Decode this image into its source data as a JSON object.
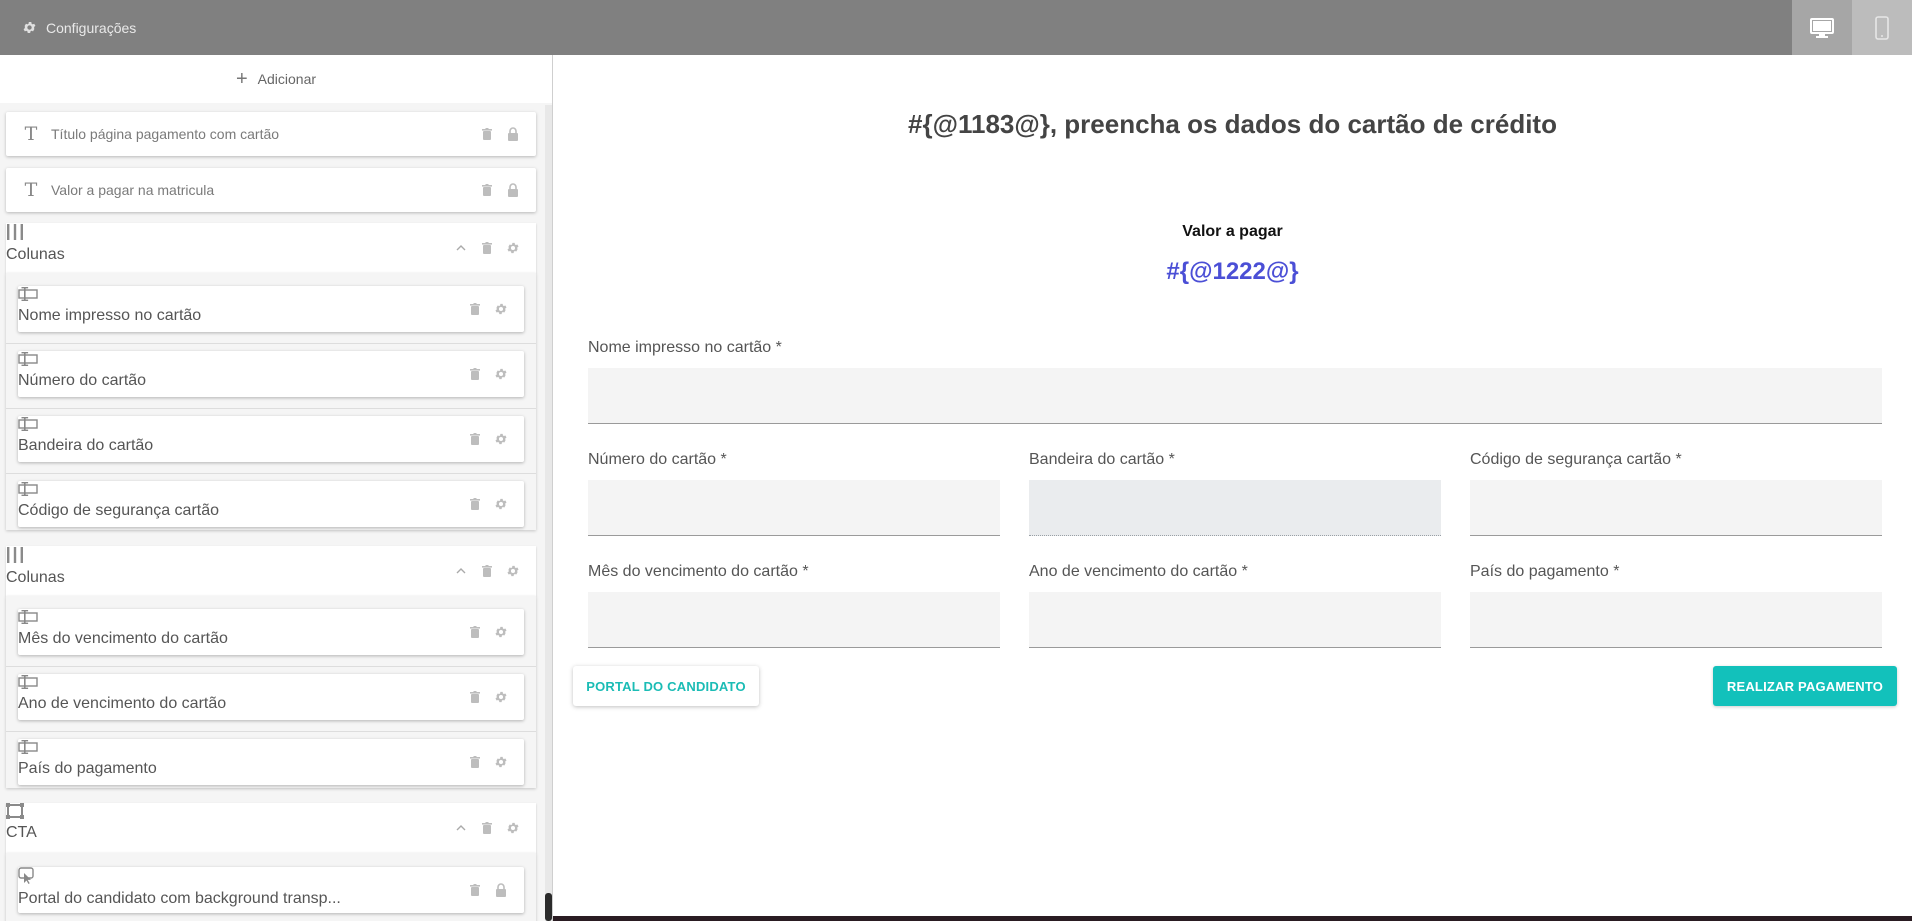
{
  "topbar": {
    "settings_label": "Configurações",
    "icons": [
      "gear-icon",
      "desktop-icon",
      "mobile-icon"
    ]
  },
  "sidebar": {
    "add_label": "Adicionar",
    "items": [
      {
        "label": "Título página pagamento com cartão",
        "icon": "text-icon"
      },
      {
        "label": "Valor a pagar na matricula",
        "icon": "text-icon"
      }
    ],
    "groups": [
      {
        "label": "Colunas",
        "icon": "columns-icon",
        "children": [
          "Nome impresso no cartão",
          "Número do cartão",
          "Bandeira do cartão",
          "Código de segurança cartão"
        ]
      },
      {
        "label": "Colunas",
        "icon": "columns-icon",
        "children": [
          "Mês do vencimento do cartão",
          "Ano de vencimento do cartão",
          "País do pagamento"
        ]
      },
      {
        "label": "CTA",
        "icon": "cta-icon",
        "children": [
          "Portal do candidato com background transp..."
        ]
      }
    ]
  },
  "main": {
    "title": "#{@1183@}, preencha os dados do cartão de crédito",
    "amount_label": "Valor a pagar",
    "amount_value": "#{@1222@}",
    "fields": {
      "name": "Nome impresso no cartão *",
      "number": "Número do cartão *",
      "brand": "Bandeira do cartão *",
      "cvv": "Código de segurança cartão *",
      "month": "Mês do vencimento do cartão *",
      "year": "Ano de vencimento do cartão *",
      "country": "País do pagamento *"
    },
    "buttons": {
      "portal": "PORTAL DO CANDIDATO",
      "pay": "REALIZAR PAGAMENTO"
    }
  },
  "colors": {
    "topbar": "#808080",
    "accent": "#12c1bb",
    "amount": "#4b4fd6"
  }
}
